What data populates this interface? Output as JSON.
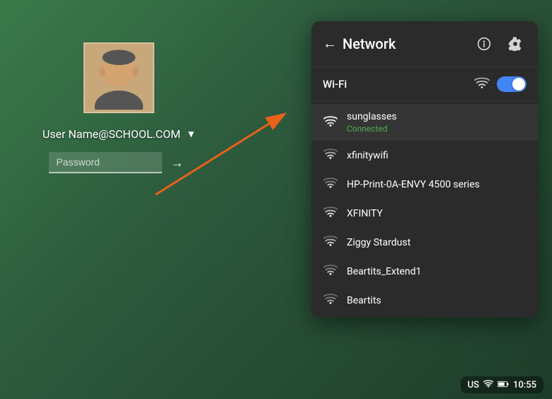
{
  "background": {
    "color": "#2d5a3d"
  },
  "login": {
    "username": "User Name@SCHOOL.COM",
    "password_placeholder": "Password",
    "dropdown_char": "▼",
    "submit_char": "→"
  },
  "network_panel": {
    "title": "Network",
    "back_icon": "←",
    "info_icon": "ⓘ",
    "settings_icon": "⚙",
    "wifi_section": {
      "label": "Wi-Fi",
      "toggle_on": true
    },
    "networks": [
      {
        "name": "sunglasses",
        "status": "Connected",
        "status_type": "connected",
        "icon": "wifi-full"
      },
      {
        "name": "xfinitywifi",
        "status": "",
        "status_type": "",
        "icon": "wifi-medium"
      },
      {
        "name": "HP-Print-0A-ENVY 4500 series",
        "status": "",
        "status_type": "",
        "icon": "wifi-low"
      },
      {
        "name": "XFINITY",
        "status": "",
        "status_type": "",
        "icon": "wifi-medium"
      },
      {
        "name": "Ziggy Stardust",
        "status": "",
        "status_type": "",
        "icon": "wifi-medium"
      },
      {
        "name": "Beartits_Extend1",
        "status": "",
        "status_type": "",
        "icon": "wifi-low"
      },
      {
        "name": "Beartits",
        "status": "",
        "status_type": "",
        "icon": "wifi-low"
      }
    ]
  },
  "taskbar": {
    "region": "US",
    "wifi_icon": "▾",
    "battery_icon": "▮",
    "time": "10:55"
  }
}
